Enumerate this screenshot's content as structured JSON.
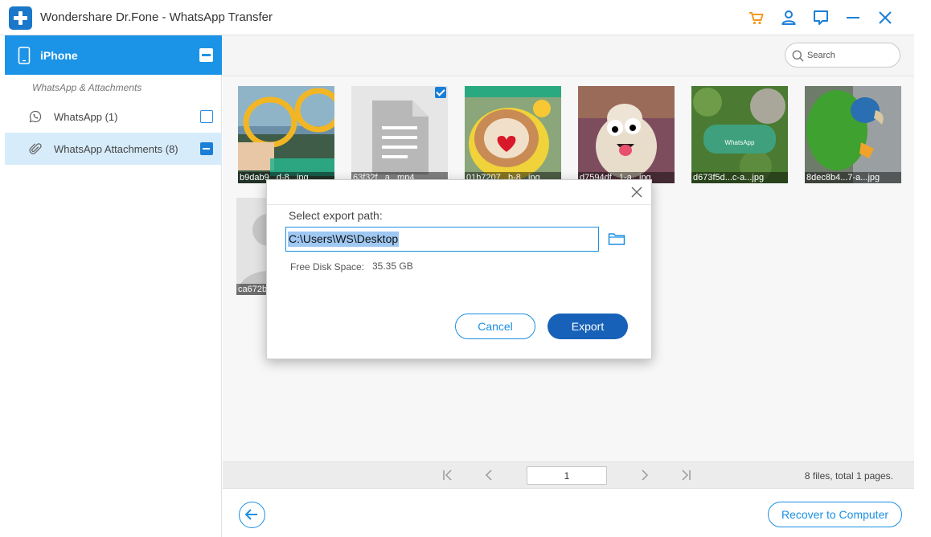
{
  "app": {
    "title": "Wondershare Dr.Fone - WhatsApp Transfer"
  },
  "titlebar": {
    "icons": [
      "cart-icon",
      "user-icon",
      "feedback-icon",
      "minimize-icon",
      "close-icon"
    ],
    "colors": {
      "cart": "#f39a1c",
      "accent": "#1b7fd8"
    }
  },
  "sidebar": {
    "device": "iPhone",
    "section_label": "WhatsApp & Attachments",
    "items": [
      {
        "label": "WhatsApp (1)",
        "icon": "whatsapp-icon",
        "selected": false
      },
      {
        "label": "WhatsApp Attachments (8)",
        "icon": "paperclip-icon",
        "selected": true
      }
    ]
  },
  "search": {
    "placeholder": "Search"
  },
  "thumbnails": [
    {
      "caption": "b9dab9...d-8...jpg"
    },
    {
      "caption": "63f32f...a...mp4",
      "checked": true
    },
    {
      "caption": "01b7207...b-8...jpg"
    },
    {
      "caption": "d7594df...1-a...jpg"
    },
    {
      "caption": "d673f5d...c-a...jpg"
    },
    {
      "caption": "8dec8b4...7-a...jpg"
    },
    {
      "caption": "ca672b"
    }
  ],
  "pagination": {
    "page": "1",
    "info": "8 files, total 1 pages."
  },
  "bottom": {
    "recover_label": "Recover to Computer"
  },
  "dialog": {
    "label": "Select export path:",
    "path": "C:\\Users\\WS\\Desktop",
    "disk_label": "Free Disk Space:",
    "disk_value": "35.35 GB",
    "cancel_label": "Cancel",
    "export_label": "Export"
  }
}
